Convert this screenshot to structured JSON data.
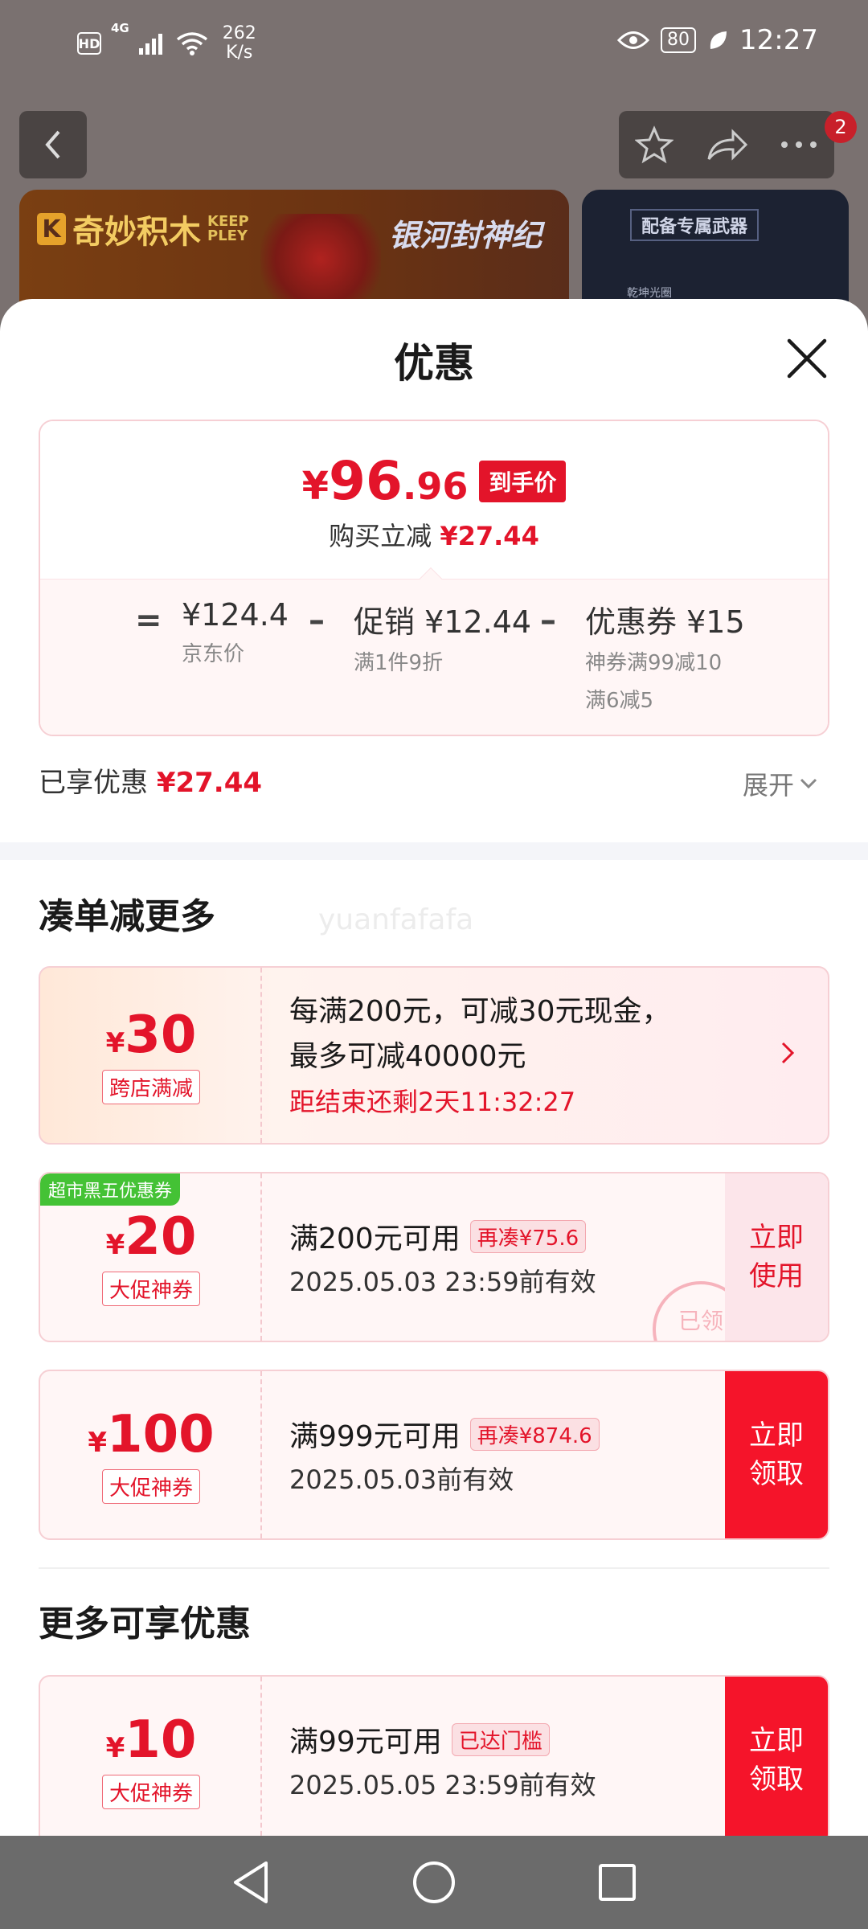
{
  "status_bar": {
    "hd": "HD",
    "network": "4G",
    "speed_value": "262",
    "speed_unit": "K/s",
    "battery": "80",
    "time": "12:27"
  },
  "background": {
    "cart_badge": "2",
    "banner_left_brand": "奇妙积木",
    "banner_left_keep": "KEEP",
    "banner_left_pley": "PLEY",
    "banner_left_title": "银河封神纪",
    "banner_right_title": "配备专属武器",
    "banner_right_sub": "乾坤光圈"
  },
  "sheet": {
    "title": "优惠",
    "summary": {
      "price_symbol": "¥",
      "price_int": "96",
      "price_dec": ".96",
      "price_tag": "到手价",
      "save_label": "购买立减",
      "save_amount": "¥27.44",
      "eq": "=",
      "jd_price": "¥124.4",
      "jd_label": "京东价",
      "minus1": "–",
      "promo_label": "促销",
      "promo_amount": "¥12.44",
      "promo_sub": "满1件9折",
      "minus2": "–",
      "coupon_label": "优惠券",
      "coupon_amount": "¥15",
      "coupon_sub1": "神券满99减10",
      "coupon_sub2": "满6减5"
    },
    "enjoyed_label": "已享优惠",
    "enjoyed_amount": "¥27.44",
    "expand_label": "展开",
    "section1_title": "凑单减更多",
    "watermark": "yuanfafafa",
    "cards": [
      {
        "symbol": "¥",
        "amount": "30",
        "chip": "跨店满减",
        "desc_line1": "每满200元，可减30元现金，",
        "desc_line2": "最多可减40000元",
        "timer": "距结束还剩2天11:32:27"
      },
      {
        "corner_tag": "超市黑五优惠券",
        "symbol": "¥",
        "amount": "20",
        "chip": "大促神券",
        "condition": "满200元可用",
        "pill": "再凑¥75.6",
        "valid": "2025.05.03 23:59前有效",
        "button_line1": "立即",
        "button_line2": "使用",
        "stamp": "已领"
      },
      {
        "symbol": "¥",
        "amount": "100",
        "chip": "大促神券",
        "condition": "满999元可用",
        "pill": "再凑¥874.6",
        "valid": "2025.05.03前有效",
        "button_line1": "立即",
        "button_line2": "领取"
      },
      {
        "symbol": "¥",
        "amount": "10",
        "chip": "大促神券",
        "condition": "满99元可用",
        "pill": "已达门槛",
        "valid": "2025.05.05 23:59前有效",
        "button_line1": "立即",
        "button_line2": "领取"
      }
    ],
    "section2_title": "更多可享优惠"
  },
  "colors": {
    "accent_red": "#e3142a",
    "green_tag": "#44c235",
    "card_border": "#f6cfd4"
  },
  "icons": [
    "back-icon",
    "star-icon",
    "share-icon",
    "more-icon",
    "close-icon",
    "chevron-down-icon",
    "chevron-right-icon",
    "nav-back-icon",
    "nav-home-icon",
    "nav-recents-icon"
  ]
}
